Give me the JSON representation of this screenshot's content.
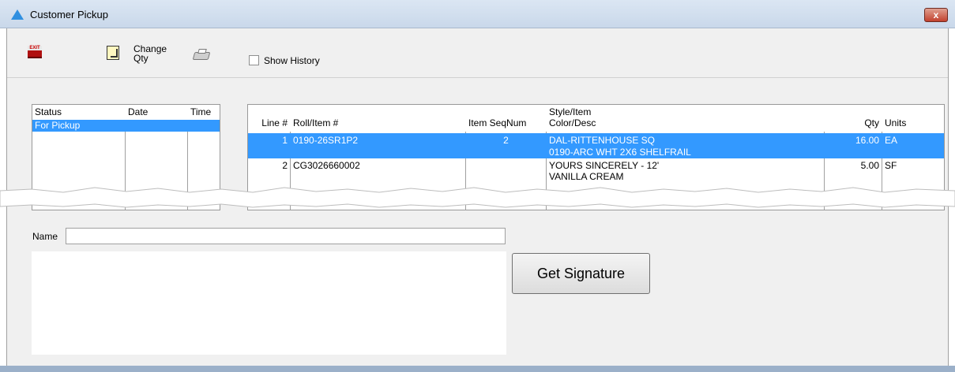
{
  "window": {
    "title": "Customer Pickup",
    "close_label": "x"
  },
  "toolbar": {
    "exit_label": "EXIT",
    "change_qty_label_line1": "Change",
    "change_qty_label_line2": "Qty",
    "show_history_label": "Show History",
    "show_history_checked": false
  },
  "status_grid": {
    "columns": [
      "Status",
      "Date",
      "Time"
    ],
    "rows": [
      {
        "status": "For Pickup",
        "date": "",
        "time": ""
      }
    ],
    "selected_row": 0
  },
  "items_grid": {
    "columns": {
      "line": "Line #",
      "roll": "Roll/Item #",
      "seq": "Item SeqNum",
      "style": "Style/Item",
      "color": "Color/Desc",
      "qty": "Qty",
      "units": "Units"
    },
    "rows": [
      {
        "line": "1",
        "roll": "0190-26SR1P2",
        "seq": "2",
        "style": "DAL-RITTENHOUSE SQ",
        "color": "0190-ARC WHT 2X6 SHELFRAIL",
        "qty": "16.00",
        "units": "EA"
      },
      {
        "line": "2",
        "roll": "CG3026660002",
        "seq": "",
        "style": "YOURS SINCERELY - 12'",
        "color": "VANILLA CREAM",
        "qty": "5.00",
        "units": "SF"
      }
    ],
    "selected_row": 0
  },
  "name_field": {
    "label": "Name",
    "value": ""
  },
  "signature": {
    "button_label": "Get Signature"
  },
  "colors": {
    "selection": "#3399ff",
    "close": "#c2412e"
  }
}
